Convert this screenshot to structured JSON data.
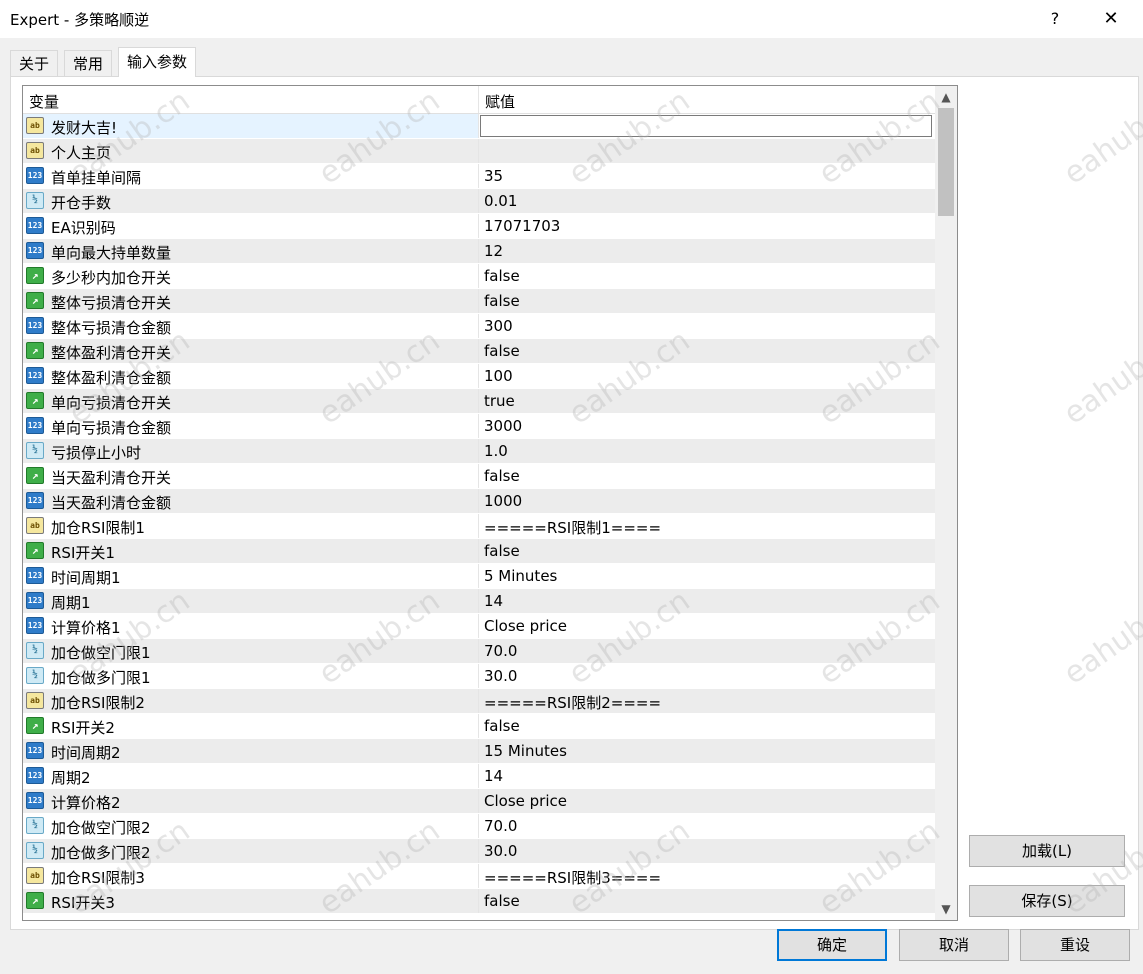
{
  "window": {
    "title": "Expert - 多策略顺逆",
    "help_label": "?",
    "close_label": "✕"
  },
  "tabs": [
    {
      "label": "关于"
    },
    {
      "label": "常用"
    },
    {
      "label": "输入参数"
    }
  ],
  "grid": {
    "col_variable": "变量",
    "col_value": "赋值",
    "rows": [
      {
        "type": "str",
        "icon": "ab",
        "name": "发财大吉!",
        "value": ""
      },
      {
        "type": "str",
        "icon": "ab",
        "name": "个人主页",
        "value": ""
      },
      {
        "type": "int",
        "icon": "123",
        "name": "首单挂单间隔",
        "value": "35"
      },
      {
        "type": "dbl",
        "icon": "½",
        "name": "开仓手数",
        "value": "0.01"
      },
      {
        "type": "int",
        "icon": "123",
        "name": "EA识别码",
        "value": "17071703"
      },
      {
        "type": "int",
        "icon": "123",
        "name": "单向最大持单数量",
        "value": "12"
      },
      {
        "type": "bool",
        "icon": "↗",
        "name": "多少秒内加仓开关",
        "value": "false"
      },
      {
        "type": "bool",
        "icon": "↗",
        "name": "整体亏损清仓开关",
        "value": "false"
      },
      {
        "type": "int",
        "icon": "123",
        "name": "整体亏损清仓金额",
        "value": "300"
      },
      {
        "type": "bool",
        "icon": "↗",
        "name": "整体盈利清仓开关",
        "value": "false"
      },
      {
        "type": "int",
        "icon": "123",
        "name": "整体盈利清仓金额",
        "value": "100"
      },
      {
        "type": "bool",
        "icon": "↗",
        "name": "单向亏损清仓开关",
        "value": "true"
      },
      {
        "type": "int",
        "icon": "123",
        "name": "单向亏损清仓金额",
        "value": "3000"
      },
      {
        "type": "dbl",
        "icon": "½",
        "name": "亏损停止小时",
        "value": "1.0"
      },
      {
        "type": "bool",
        "icon": "↗",
        "name": "当天盈利清仓开关",
        "value": "false"
      },
      {
        "type": "int",
        "icon": "123",
        "name": "当天盈利清仓金额",
        "value": "1000"
      },
      {
        "type": "str",
        "icon": "ab",
        "name": "加仓RSI限制1",
        "value": "=====RSI限制1===="
      },
      {
        "type": "bool",
        "icon": "↗",
        "name": "RSI开关1",
        "value": "false"
      },
      {
        "type": "int",
        "icon": "123",
        "name": "时间周期1",
        "value": "5 Minutes"
      },
      {
        "type": "int",
        "icon": "123",
        "name": "周期1",
        "value": "14"
      },
      {
        "type": "int",
        "icon": "123",
        "name": "计算价格1",
        "value": "Close price"
      },
      {
        "type": "dbl",
        "icon": "½",
        "name": "加仓做空门限1",
        "value": "70.0"
      },
      {
        "type": "dbl",
        "icon": "½",
        "name": "加仓做多门限1",
        "value": "30.0"
      },
      {
        "type": "str",
        "icon": "ab",
        "name": "加仓RSI限制2",
        "value": "=====RSI限制2===="
      },
      {
        "type": "bool",
        "icon": "↗",
        "name": "RSI开关2",
        "value": "false"
      },
      {
        "type": "int",
        "icon": "123",
        "name": "时间周期2",
        "value": "15 Minutes"
      },
      {
        "type": "int",
        "icon": "123",
        "name": "周期2",
        "value": "14"
      },
      {
        "type": "int",
        "icon": "123",
        "name": "计算价格2",
        "value": "Close price"
      },
      {
        "type": "dbl",
        "icon": "½",
        "name": "加仓做空门限2",
        "value": "70.0"
      },
      {
        "type": "dbl",
        "icon": "½",
        "name": "加仓做多门限2",
        "value": "30.0"
      },
      {
        "type": "str",
        "icon": "ab",
        "name": "加仓RSI限制3",
        "value": "=====RSI限制3===="
      },
      {
        "type": "bool",
        "icon": "↗",
        "name": "RSI开关3",
        "value": "false"
      }
    ]
  },
  "side_buttons": {
    "load_label": "加载(L)",
    "save_label": "保存(S)"
  },
  "footer_buttons": {
    "ok_label": "确定",
    "cancel_label": "取消",
    "reset_label": "重设"
  },
  "watermark": "eahub.cn"
}
